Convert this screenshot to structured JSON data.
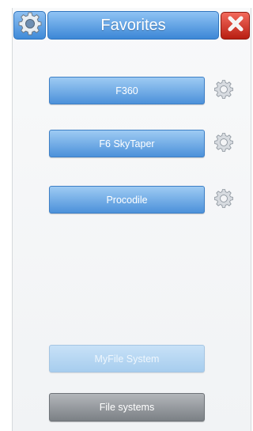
{
  "header": {
    "title": "Favorites",
    "settings_icon": "gear-icon",
    "close_icon": "close-icon",
    "accent_color": "#3f8ad8",
    "close_color": "#c8281b"
  },
  "favorites": [
    {
      "label": "F360",
      "icon": "gear-icon"
    },
    {
      "label": "F6 SkyTaper",
      "icon": "gear-icon"
    },
    {
      "label": "Procodile",
      "icon": "gear-icon"
    }
  ],
  "bottom": {
    "myfile_label": "MyFile System",
    "filesystems_label": "File systems"
  }
}
